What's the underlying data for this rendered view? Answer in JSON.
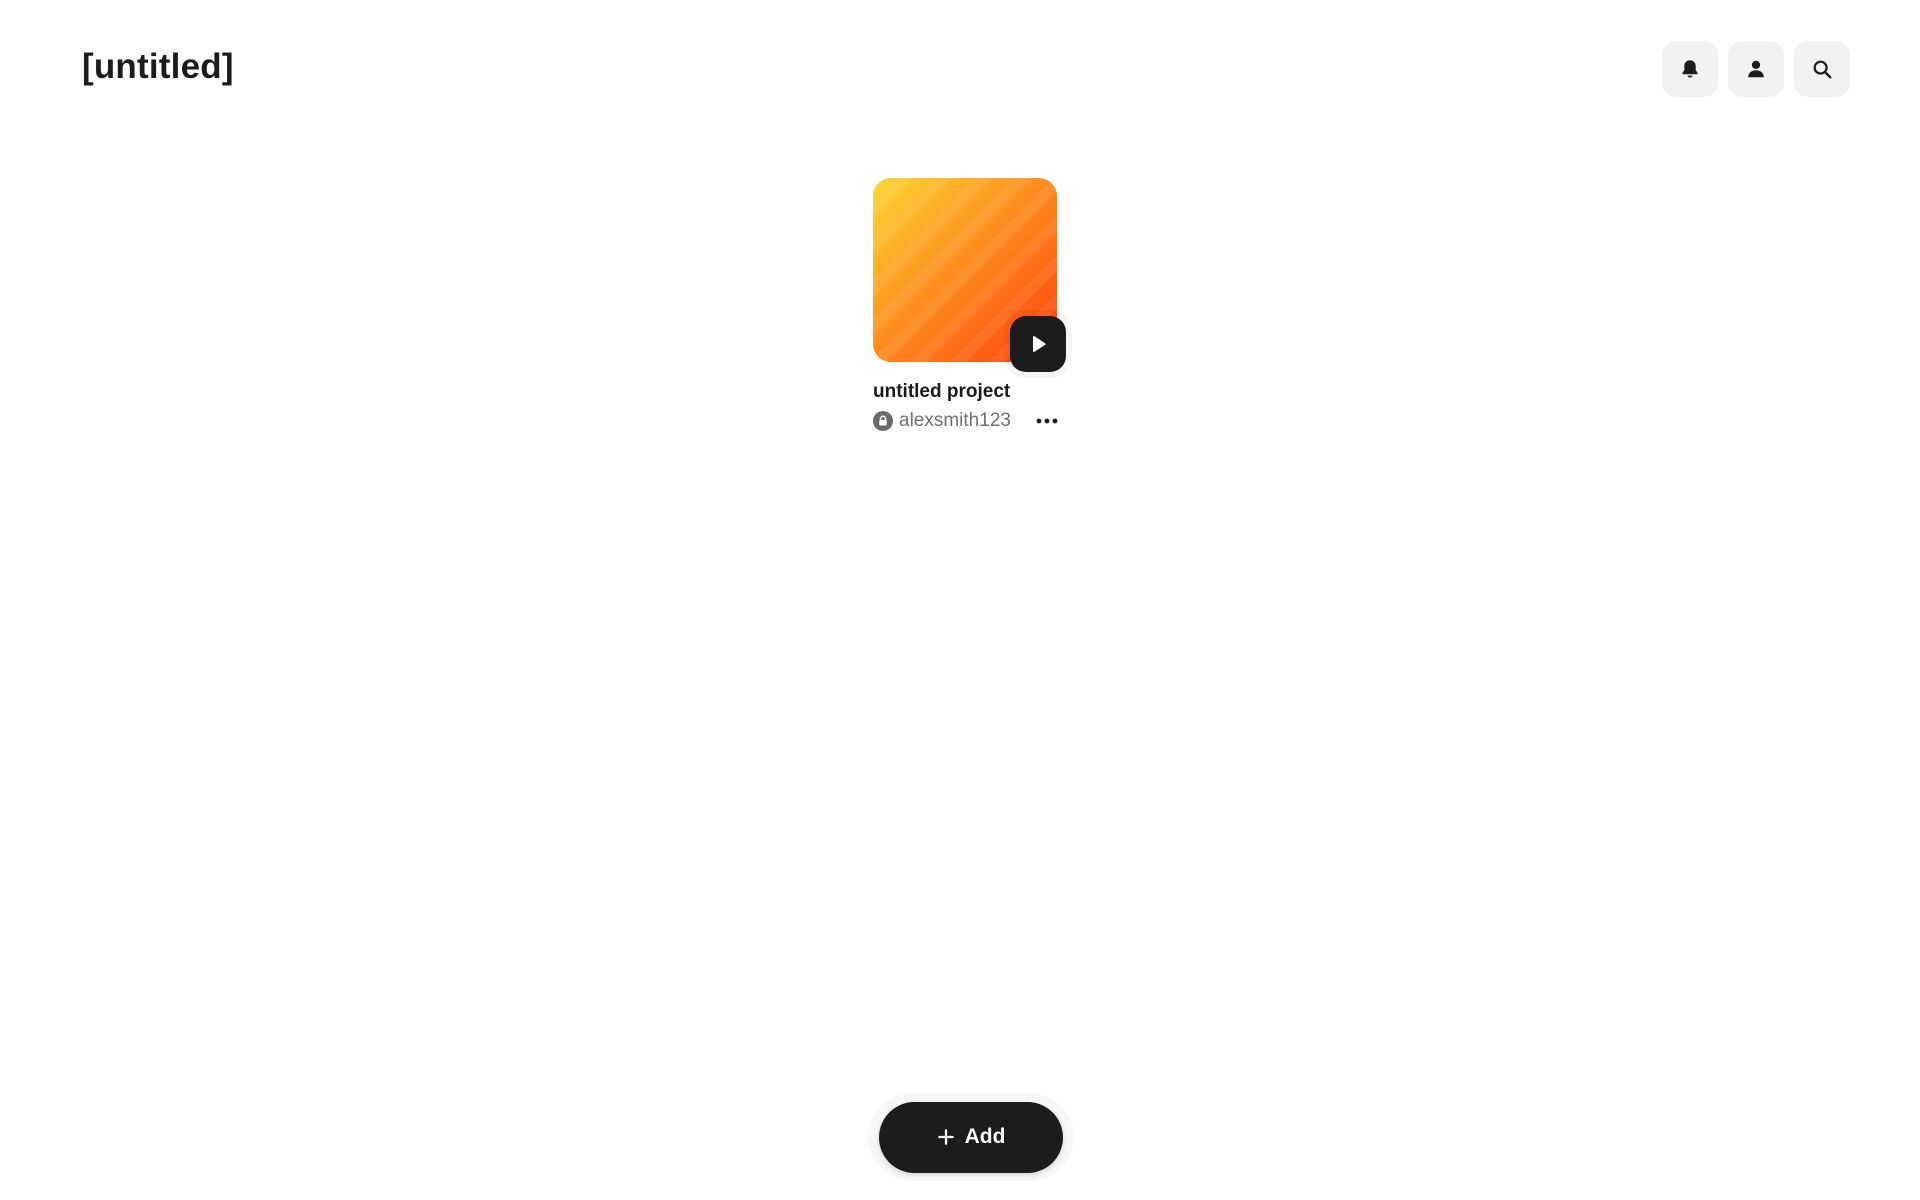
{
  "header": {
    "title": "[untitled]",
    "actions": [
      {
        "icon": "bell-icon"
      },
      {
        "icon": "user-icon"
      },
      {
        "icon": "search-icon"
      }
    ]
  },
  "projects": [
    {
      "title": "untitled project",
      "owner": "alexsmith123",
      "visibility_icon": "lock-icon",
      "thumbnail_colors": [
        "#fdd835",
        "#ffa726",
        "#ff7a1a",
        "#ff3d0a"
      ]
    }
  ],
  "footer": {
    "add_label": "Add"
  },
  "colors": {
    "dark": "#1c1c1c",
    "icon_button_bg": "#f2f2f2",
    "muted_text": "#707070"
  }
}
